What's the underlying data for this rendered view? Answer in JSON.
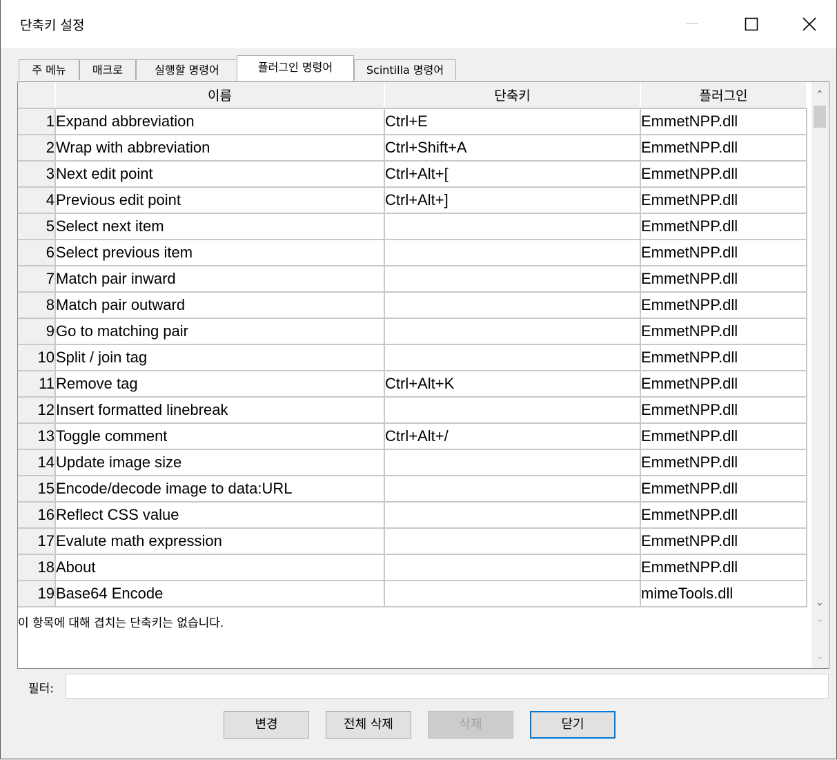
{
  "window": {
    "title": "단축키 설정"
  },
  "tabs": [
    {
      "label": "주 메뉴",
      "active": false
    },
    {
      "label": "매크로",
      "active": false
    },
    {
      "label": "실행할 명령어",
      "active": false
    },
    {
      "label": "플러그인 명령어",
      "active": true
    },
    {
      "label": "Scintilla 명령어",
      "active": false
    }
  ],
  "grid": {
    "headers": {
      "name": "이름",
      "shortcut": "단축키",
      "plugin": "플러그인"
    },
    "rows": [
      {
        "num": "1",
        "name": "Expand abbreviation",
        "shortcut": "Ctrl+E",
        "plugin": "EmmetNPP.dll"
      },
      {
        "num": "2",
        "name": "Wrap with abbreviation",
        "shortcut": "Ctrl+Shift+A",
        "plugin": "EmmetNPP.dll"
      },
      {
        "num": "3",
        "name": "Next edit point",
        "shortcut": "Ctrl+Alt+[",
        "plugin": "EmmetNPP.dll"
      },
      {
        "num": "4",
        "name": "Previous edit point",
        "shortcut": "Ctrl+Alt+]",
        "plugin": "EmmetNPP.dll"
      },
      {
        "num": "5",
        "name": "Select next item",
        "shortcut": "",
        "plugin": "EmmetNPP.dll"
      },
      {
        "num": "6",
        "name": "Select previous item",
        "shortcut": "",
        "plugin": "EmmetNPP.dll"
      },
      {
        "num": "7",
        "name": "Match pair inward",
        "shortcut": "",
        "plugin": "EmmetNPP.dll"
      },
      {
        "num": "8",
        "name": "Match pair outward",
        "shortcut": "",
        "plugin": "EmmetNPP.dll"
      },
      {
        "num": "9",
        "name": "Go to matching pair",
        "shortcut": "",
        "plugin": "EmmetNPP.dll"
      },
      {
        "num": "10",
        "name": "Split / join tag",
        "shortcut": "",
        "plugin": "EmmetNPP.dll"
      },
      {
        "num": "11",
        "name": "Remove tag",
        "shortcut": "Ctrl+Alt+K",
        "plugin": "EmmetNPP.dll"
      },
      {
        "num": "12",
        "name": "Insert formatted linebreak",
        "shortcut": "",
        "plugin": "EmmetNPP.dll"
      },
      {
        "num": "13",
        "name": "Toggle comment",
        "shortcut": "Ctrl+Alt+/",
        "plugin": "EmmetNPP.dll"
      },
      {
        "num": "14",
        "name": "Update image size",
        "shortcut": "",
        "plugin": "EmmetNPP.dll"
      },
      {
        "num": "15",
        "name": "Encode/decode image to data:URL",
        "shortcut": "",
        "plugin": "EmmetNPP.dll"
      },
      {
        "num": "16",
        "name": "Reflect CSS value",
        "shortcut": "",
        "plugin": "EmmetNPP.dll"
      },
      {
        "num": "17",
        "name": "Evalute math expression",
        "shortcut": "",
        "plugin": "EmmetNPP.dll"
      },
      {
        "num": "18",
        "name": "About",
        "shortcut": "",
        "plugin": "EmmetNPP.dll"
      },
      {
        "num": "19",
        "name": "Base64 Encode",
        "shortcut": "",
        "plugin": "mimeTools.dll"
      }
    ]
  },
  "conflict_message": "이 항목에 대해 겹치는 단축키는 없습니다.",
  "filter": {
    "label": "필터:",
    "value": ""
  },
  "buttons": {
    "modify": "변경",
    "clear": "전체 삭제",
    "delete": "삭제",
    "close": "닫기"
  },
  "icons": {
    "minimize": "minimize-icon",
    "maximize": "maximize-icon",
    "close": "close-icon"
  },
  "colors": {
    "grid_line": "#c8c8c8",
    "header_bg": "#f0f0f0",
    "default_button_border": "#0078d7"
  }
}
